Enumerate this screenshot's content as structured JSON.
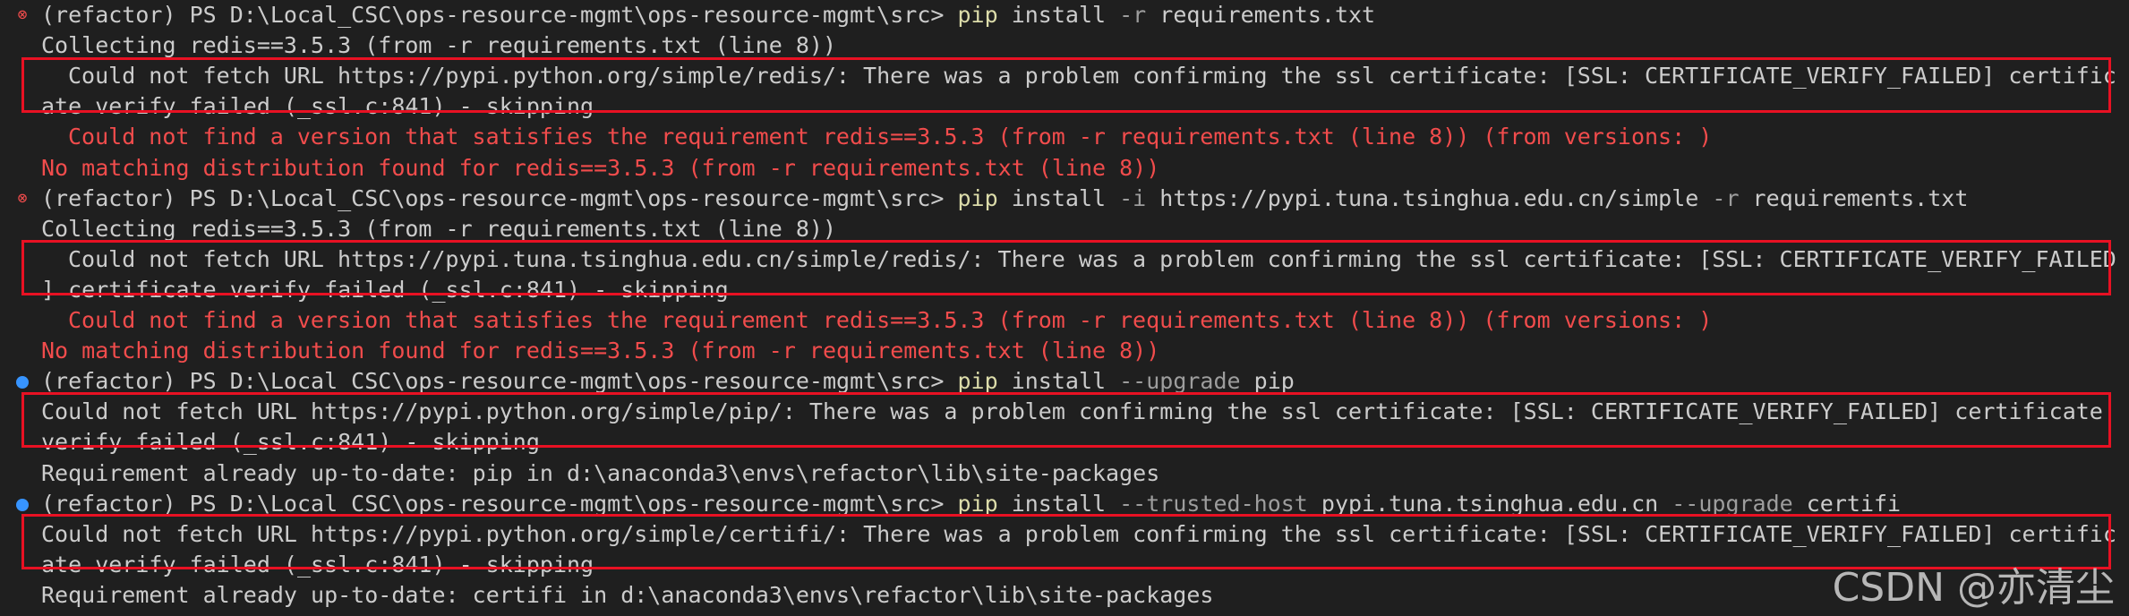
{
  "lines": [
    {
      "gutter": "error",
      "indent": 0,
      "style": "prompt",
      "prompt": "(refactor) PS D:\\Local_CSC\\ops-resource-mgmt\\ops-resource-mgmt\\src> ",
      "pip": "pip",
      "rest": " install ",
      "flag1": "-r",
      "rest2": " requirements.txt"
    },
    {
      "gutter": "",
      "indent": 0,
      "style": "plain",
      "text": "Collecting redis==3.5.3 (from -r requirements.txt (line 8))"
    },
    {
      "gutter": "",
      "indent": 1,
      "style": "plain",
      "text": "Could not fetch URL https://pypi.python.org/simple/redis/: There was a problem confirming the ssl certificate: [SSL: CERTIFICATE_VERIFY_FAILED] certific"
    },
    {
      "gutter": "",
      "indent": 0,
      "style": "plain",
      "text": "ate verify failed (_ssl.c:841) - skipping"
    },
    {
      "gutter": "",
      "indent": 1,
      "style": "red",
      "text": "Could not find a version that satisfies the requirement redis==3.5.3 (from -r requirements.txt (line 8)) (from versions: )"
    },
    {
      "gutter": "",
      "indent": 0,
      "style": "red",
      "text": "No matching distribution found for redis==3.5.3 (from -r requirements.txt (line 8))"
    },
    {
      "gutter": "error",
      "indent": 0,
      "style": "prompt",
      "prompt": "(refactor) PS D:\\Local_CSC\\ops-resource-mgmt\\ops-resource-mgmt\\src> ",
      "pip": "pip",
      "rest": " install ",
      "flag1": "-i",
      "rest2": " https://pypi.tuna.tsinghua.edu.cn/simple ",
      "flag2": "-r",
      "rest3": " requirements.txt"
    },
    {
      "gutter": "",
      "indent": 0,
      "style": "plain",
      "text": "Collecting redis==3.5.3 (from -r requirements.txt (line 8))"
    },
    {
      "gutter": "",
      "indent": 1,
      "style": "plain",
      "text": "Could not fetch URL https://pypi.tuna.tsinghua.edu.cn/simple/redis/: There was a problem confirming the ssl certificate: [SSL: CERTIFICATE_VERIFY_FAILED"
    },
    {
      "gutter": "",
      "indent": 0,
      "style": "plain",
      "text": "] certificate verify failed (_ssl.c:841) - skipping"
    },
    {
      "gutter": "",
      "indent": 1,
      "style": "red",
      "text": "Could not find a version that satisfies the requirement redis==3.5.3 (from -r requirements.txt (line 8)) (from versions: )"
    },
    {
      "gutter": "",
      "indent": 0,
      "style": "red",
      "text": "No matching distribution found for redis==3.5.3 (from -r requirements.txt (line 8))"
    },
    {
      "gutter": "dot",
      "indent": 0,
      "style": "prompt",
      "prompt": "(refactor) PS D:\\Local_CSC\\ops-resource-mgmt\\ops-resource-mgmt\\src> ",
      "pip": "pip",
      "rest": " install ",
      "flag1": "--upgrade",
      "rest2": " pip"
    },
    {
      "gutter": "",
      "indent": 0,
      "style": "plain",
      "text": "Could not fetch URL https://pypi.python.org/simple/pip/: There was a problem confirming the ssl certificate: [SSL: CERTIFICATE_VERIFY_FAILED] certificate"
    },
    {
      "gutter": "",
      "indent": 0,
      "style": "plain",
      "text": "verify failed (_ssl.c:841) - skipping"
    },
    {
      "gutter": "",
      "indent": 0,
      "style": "plain",
      "text": "Requirement already up-to-date: pip in d:\\anaconda3\\envs\\refactor\\lib\\site-packages"
    },
    {
      "gutter": "dot",
      "indent": 0,
      "style": "prompt",
      "prompt": "(refactor) PS D:\\Local_CSC\\ops-resource-mgmt\\ops-resource-mgmt\\src> ",
      "pip": "pip",
      "rest": " install ",
      "flag1": "--trusted-host",
      "rest2": " pypi.tuna.tsinghua.edu.cn ",
      "flag2": "--upgrade",
      "rest3": " certifi"
    },
    {
      "gutter": "",
      "indent": 0,
      "style": "plain",
      "text": "Could not fetch URL https://pypi.python.org/simple/certifi/: There was a problem confirming the ssl certificate: [SSL: CERTIFICATE_VERIFY_FAILED] certific"
    },
    {
      "gutter": "",
      "indent": 0,
      "style": "plain",
      "text": "ate verify failed (_ssl.c:841) - skipping"
    },
    {
      "gutter": "",
      "indent": 0,
      "style": "plain",
      "text": "Requirement already up-to-date: certifi in d:\\anaconda3\\envs\\refactor\\lib\\site-packages"
    }
  ],
  "watermark": "CSDN @亦清尘",
  "colors": {
    "background": "#1f1f1f",
    "text": "#cccccc",
    "error_text": "#f14c4c",
    "command": "#dcdcaa",
    "flag": "#9d9d9d",
    "highlight_box": "#e81123",
    "dot": "#3794ff"
  }
}
